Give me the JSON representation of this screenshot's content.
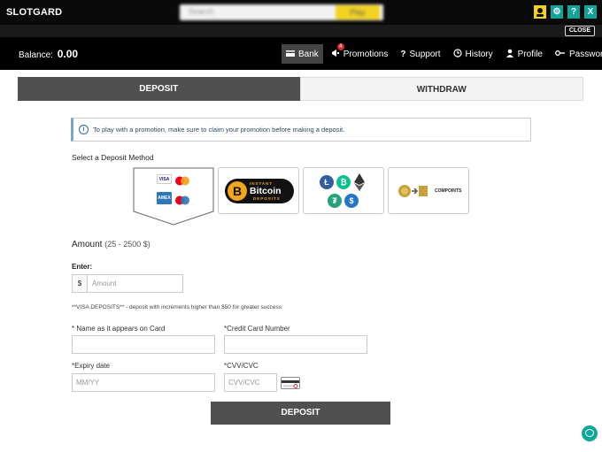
{
  "header": {
    "logo": "SLOTGARD",
    "search": {
      "placeholder": "Search",
      "button_label": "Play"
    },
    "icons": [
      "user-icon",
      "gear-icon",
      "help-icon",
      "close-icon"
    ],
    "icon_labels": [
      "⚙",
      "?",
      "X"
    ]
  },
  "subbar": {
    "close_label": "CLOSE"
  },
  "nav": {
    "balance_label": "Balance:",
    "balance_value": "0.00",
    "items": [
      {
        "label": "Bank",
        "icon": "bank-icon",
        "active": true
      },
      {
        "label": "Promotions",
        "icon": "megaphone-icon",
        "badge": "4"
      },
      {
        "label": "Support",
        "icon": "question-icon"
      },
      {
        "label": "History",
        "icon": "history-icon"
      },
      {
        "label": "Profile",
        "icon": "user-icon"
      },
      {
        "label": "Password",
        "icon": "key-icon"
      }
    ]
  },
  "tabs": [
    {
      "label": "DEPOSIT",
      "active": true
    },
    {
      "label": "WITHDRAW",
      "active": false
    }
  ],
  "info": {
    "text": "To play with a promotion, make sure to claim your promotion before making a deposit."
  },
  "deposit_methods": {
    "title": "Select a Deposit Method",
    "methods": [
      {
        "name": "cards",
        "labels": [
          "VISA",
          "AMEX"
        ],
        "selected": true
      },
      {
        "name": "instant-bitcoin",
        "labels": [
          "INSTANT",
          "Bitcoin",
          "DEPOSITS"
        ]
      },
      {
        "name": "crypto",
        "labels": [
          "Ł",
          "₿",
          "◆",
          "₮",
          "$"
        ]
      },
      {
        "name": "comp-points",
        "labels": [
          "COMPOINTS"
        ]
      }
    ]
  },
  "amount": {
    "label": "Amount",
    "range": "(25 - 2500 $)",
    "enter_label": "Enter:",
    "currency": "$",
    "placeholder": "Amount"
  },
  "visa_note": "**VISA DEPOSITS** - deposit with increments higher than $50 for greater success",
  "form": {
    "name_label": "* Name as it appears on Card",
    "card_number_label": "*Credit Card Number",
    "expiry_label": "*Expiry date",
    "expiry_placeholder": "MM/YY",
    "cvv_label": "*CVV/CVC",
    "cvv_placeholder": "CVV/CVC"
  },
  "deposit_button": "DEPOSIT",
  "colors": {
    "accent_teal": "#0fa898",
    "active_tab": "#4f4f4f",
    "bitcoin_orange": "#f3a51b",
    "search_yellow": "#f3d21f"
  }
}
